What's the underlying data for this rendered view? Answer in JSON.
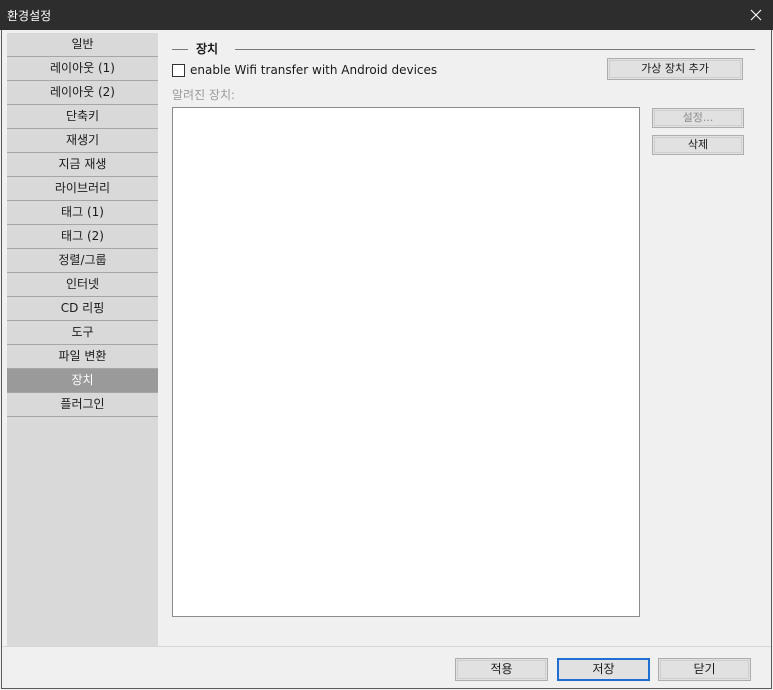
{
  "window": {
    "title": "환경설정"
  },
  "sidebar": {
    "items": [
      {
        "label": "일반"
      },
      {
        "label": "레이아웃 (1)"
      },
      {
        "label": "레이아웃 (2)"
      },
      {
        "label": "단축키"
      },
      {
        "label": "재생기"
      },
      {
        "label": "지금 재생"
      },
      {
        "label": "라이브러리"
      },
      {
        "label": "태그 (1)"
      },
      {
        "label": "태그 (2)"
      },
      {
        "label": "정렬/그룹"
      },
      {
        "label": "인터넷"
      },
      {
        "label": "CD 리핑"
      },
      {
        "label": "도구"
      },
      {
        "label": "파일 변환"
      },
      {
        "label": "장치"
      },
      {
        "label": "플러그인"
      }
    ],
    "selected": "장치"
  },
  "devices": {
    "group_title": "장치",
    "wifi_checkbox_label": "enable Wifi transfer with Android devices",
    "wifi_checked": false,
    "add_virtual_button": "가상 장치 추가",
    "known_devices_label": "알려진 장치:",
    "known_devices": [],
    "settings_button": "설정...",
    "delete_button": "삭제"
  },
  "footer": {
    "apply_button": "적용",
    "save_button": "저장",
    "close_button": "닫기"
  },
  "colors": {
    "titlebar": "#2d2d2d",
    "sidebar_bg": "#d9d9d9",
    "selected_item_bg": "#9a9a9a",
    "default_button_border": "#1f6fd1"
  }
}
